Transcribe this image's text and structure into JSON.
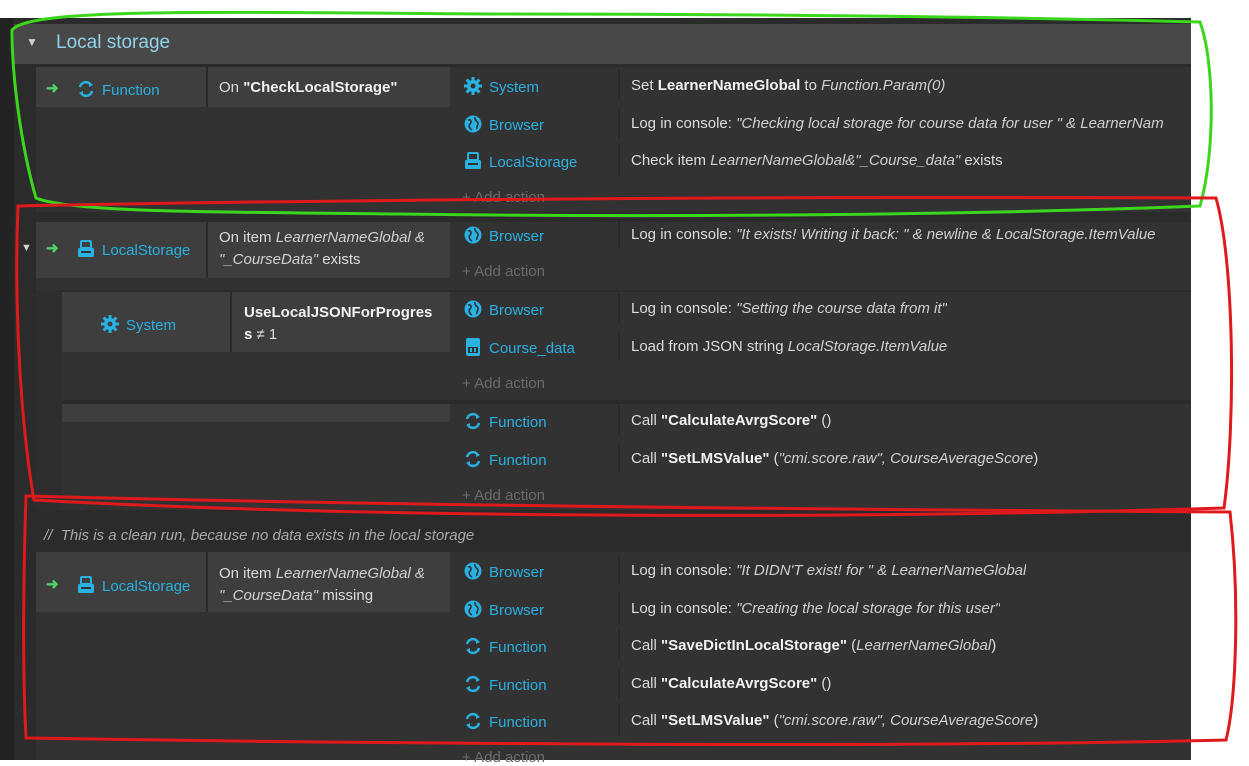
{
  "group": {
    "title": "Local storage"
  },
  "event1": {
    "object": "Function",
    "condition_prefix": "On ",
    "condition_name": "\"CheckLocalStorage\"",
    "actions": [
      {
        "object": "System",
        "icon": "gear-icon",
        "parts": [
          "Set ",
          "LearnerNameGlobal",
          " to ",
          "Function.Param(0)"
        ]
      },
      {
        "object": "Browser",
        "icon": "globe-icon",
        "parts": [
          "Log in console: ",
          "\"Checking local storage for course data for user \" & LearnerNam"
        ]
      },
      {
        "object": "LocalStorage",
        "icon": "storage-icon",
        "parts": [
          "Check item ",
          "LearnerNameGlobal&\"_Course_data\"",
          " exists"
        ]
      }
    ],
    "add_action": "Add action"
  },
  "event2": {
    "object": "LocalStorage",
    "condition_line1_prefix": "On item ",
    "condition_line1_italic": "LearnerNameGlobal &",
    "condition_line2_italic": "\"_CourseData\"",
    "condition_line2_suffix": " exists",
    "actions": [
      {
        "object": "Browser",
        "icon": "globe-icon",
        "parts": [
          "Log in console: ",
          "\"It exists! Writing it back: \" & newline & LocalStorage.ItemValue"
        ]
      }
    ],
    "add_action": "Add action"
  },
  "sub1": {
    "object": "System",
    "condition_line1": "UseLocalJSONForProgres",
    "condition_line2_bold": "s",
    "condition_line2_suffix": " ≠ 1",
    "actions": [
      {
        "object": "Browser",
        "icon": "globe-icon",
        "parts": [
          "Log in console: ",
          "\"Setting the course data from it\""
        ]
      },
      {
        "object": "Course_data",
        "icon": "json-icon",
        "parts": [
          "Load from JSON string ",
          "LocalStorage.ItemValue"
        ]
      }
    ],
    "add_action": "Add action"
  },
  "sub2": {
    "actions": [
      {
        "object": "Function",
        "icon": "function-icon",
        "parts": [
          "Call ",
          "\"CalculateAvrgScore\"",
          " ()"
        ]
      },
      {
        "object": "Function",
        "icon": "function-icon",
        "parts": [
          "Call ",
          "\"SetLMSValue\"",
          " (",
          "\"cmi.score.raw\", CourseAverageScore",
          ")"
        ]
      }
    ],
    "add_action": "Add action"
  },
  "comment": "This is a clean run, because no data exists in the local storage",
  "comment_slashes": "//",
  "event3": {
    "object": "LocalStorage",
    "condition_line1_prefix": "On item ",
    "condition_line1_italic": "LearnerNameGlobal &",
    "condition_line2_italic": "\"_CourseData\"",
    "condition_line2_suffix": " missing",
    "actions": [
      {
        "object": "Browser",
        "icon": "globe-icon",
        "parts": [
          "Log in console: ",
          "\"It DIDN'T exist! for \" & LearnerNameGlobal"
        ]
      },
      {
        "object": "Browser",
        "icon": "globe-icon",
        "parts": [
          "Log in console: ",
          "\"Creating the local storage for this user\""
        ]
      },
      {
        "object": "Function",
        "icon": "function-icon",
        "parts": [
          "Call ",
          "\"SaveDictInLocalStorage\"",
          " (",
          "LearnerNameGlobal",
          ")"
        ]
      },
      {
        "object": "Function",
        "icon": "function-icon",
        "parts": [
          "Call ",
          "\"CalculateAvrgScore\"",
          " ()"
        ]
      },
      {
        "object": "Function",
        "icon": "function-icon",
        "parts": [
          "Call ",
          "\"SetLMSValue\"",
          " (",
          "\"cmi.score.raw\", CourseAverageScore",
          ")"
        ]
      }
    ],
    "add_action": "Add action"
  },
  "colors": {
    "object_blue": "#29b1e2",
    "trigger_green": "#4fd06a",
    "annotation_green": "#3cd61c",
    "annotation_red": "#e0191c"
  }
}
